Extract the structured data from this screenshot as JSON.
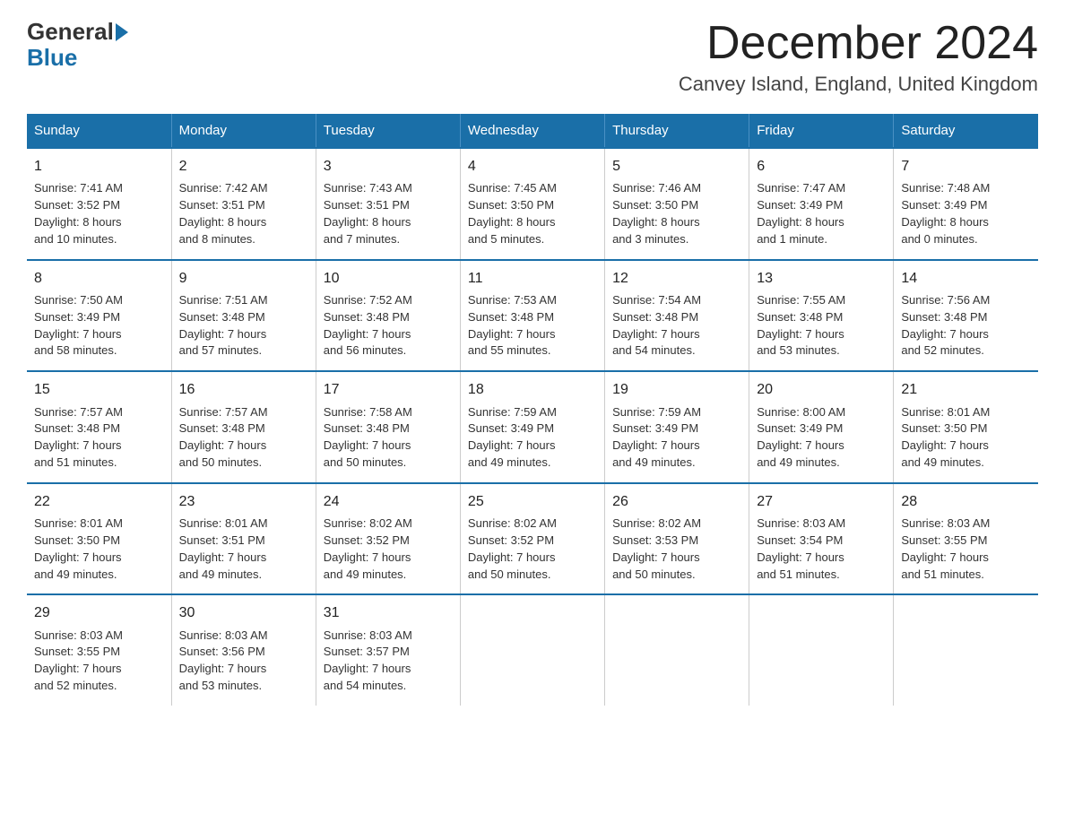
{
  "logo": {
    "general": "General",
    "blue": "Blue"
  },
  "title": "December 2024",
  "location": "Canvey Island, England, United Kingdom",
  "days_of_week": [
    "Sunday",
    "Monday",
    "Tuesday",
    "Wednesday",
    "Thursday",
    "Friday",
    "Saturday"
  ],
  "weeks": [
    [
      {
        "day": "1",
        "info": "Sunrise: 7:41 AM\nSunset: 3:52 PM\nDaylight: 8 hours\nand 10 minutes."
      },
      {
        "day": "2",
        "info": "Sunrise: 7:42 AM\nSunset: 3:51 PM\nDaylight: 8 hours\nand 8 minutes."
      },
      {
        "day": "3",
        "info": "Sunrise: 7:43 AM\nSunset: 3:51 PM\nDaylight: 8 hours\nand 7 minutes."
      },
      {
        "day": "4",
        "info": "Sunrise: 7:45 AM\nSunset: 3:50 PM\nDaylight: 8 hours\nand 5 minutes."
      },
      {
        "day": "5",
        "info": "Sunrise: 7:46 AM\nSunset: 3:50 PM\nDaylight: 8 hours\nand 3 minutes."
      },
      {
        "day": "6",
        "info": "Sunrise: 7:47 AM\nSunset: 3:49 PM\nDaylight: 8 hours\nand 1 minute."
      },
      {
        "day": "7",
        "info": "Sunrise: 7:48 AM\nSunset: 3:49 PM\nDaylight: 8 hours\nand 0 minutes."
      }
    ],
    [
      {
        "day": "8",
        "info": "Sunrise: 7:50 AM\nSunset: 3:49 PM\nDaylight: 7 hours\nand 58 minutes."
      },
      {
        "day": "9",
        "info": "Sunrise: 7:51 AM\nSunset: 3:48 PM\nDaylight: 7 hours\nand 57 minutes."
      },
      {
        "day": "10",
        "info": "Sunrise: 7:52 AM\nSunset: 3:48 PM\nDaylight: 7 hours\nand 56 minutes."
      },
      {
        "day": "11",
        "info": "Sunrise: 7:53 AM\nSunset: 3:48 PM\nDaylight: 7 hours\nand 55 minutes."
      },
      {
        "day": "12",
        "info": "Sunrise: 7:54 AM\nSunset: 3:48 PM\nDaylight: 7 hours\nand 54 minutes."
      },
      {
        "day": "13",
        "info": "Sunrise: 7:55 AM\nSunset: 3:48 PM\nDaylight: 7 hours\nand 53 minutes."
      },
      {
        "day": "14",
        "info": "Sunrise: 7:56 AM\nSunset: 3:48 PM\nDaylight: 7 hours\nand 52 minutes."
      }
    ],
    [
      {
        "day": "15",
        "info": "Sunrise: 7:57 AM\nSunset: 3:48 PM\nDaylight: 7 hours\nand 51 minutes."
      },
      {
        "day": "16",
        "info": "Sunrise: 7:57 AM\nSunset: 3:48 PM\nDaylight: 7 hours\nand 50 minutes."
      },
      {
        "day": "17",
        "info": "Sunrise: 7:58 AM\nSunset: 3:48 PM\nDaylight: 7 hours\nand 50 minutes."
      },
      {
        "day": "18",
        "info": "Sunrise: 7:59 AM\nSunset: 3:49 PM\nDaylight: 7 hours\nand 49 minutes."
      },
      {
        "day": "19",
        "info": "Sunrise: 7:59 AM\nSunset: 3:49 PM\nDaylight: 7 hours\nand 49 minutes."
      },
      {
        "day": "20",
        "info": "Sunrise: 8:00 AM\nSunset: 3:49 PM\nDaylight: 7 hours\nand 49 minutes."
      },
      {
        "day": "21",
        "info": "Sunrise: 8:01 AM\nSunset: 3:50 PM\nDaylight: 7 hours\nand 49 minutes."
      }
    ],
    [
      {
        "day": "22",
        "info": "Sunrise: 8:01 AM\nSunset: 3:50 PM\nDaylight: 7 hours\nand 49 minutes."
      },
      {
        "day": "23",
        "info": "Sunrise: 8:01 AM\nSunset: 3:51 PM\nDaylight: 7 hours\nand 49 minutes."
      },
      {
        "day": "24",
        "info": "Sunrise: 8:02 AM\nSunset: 3:52 PM\nDaylight: 7 hours\nand 49 minutes."
      },
      {
        "day": "25",
        "info": "Sunrise: 8:02 AM\nSunset: 3:52 PM\nDaylight: 7 hours\nand 50 minutes."
      },
      {
        "day": "26",
        "info": "Sunrise: 8:02 AM\nSunset: 3:53 PM\nDaylight: 7 hours\nand 50 minutes."
      },
      {
        "day": "27",
        "info": "Sunrise: 8:03 AM\nSunset: 3:54 PM\nDaylight: 7 hours\nand 51 minutes."
      },
      {
        "day": "28",
        "info": "Sunrise: 8:03 AM\nSunset: 3:55 PM\nDaylight: 7 hours\nand 51 minutes."
      }
    ],
    [
      {
        "day": "29",
        "info": "Sunrise: 8:03 AM\nSunset: 3:55 PM\nDaylight: 7 hours\nand 52 minutes."
      },
      {
        "day": "30",
        "info": "Sunrise: 8:03 AM\nSunset: 3:56 PM\nDaylight: 7 hours\nand 53 minutes."
      },
      {
        "day": "31",
        "info": "Sunrise: 8:03 AM\nSunset: 3:57 PM\nDaylight: 7 hours\nand 54 minutes."
      },
      {
        "day": "",
        "info": ""
      },
      {
        "day": "",
        "info": ""
      },
      {
        "day": "",
        "info": ""
      },
      {
        "day": "",
        "info": ""
      }
    ]
  ]
}
